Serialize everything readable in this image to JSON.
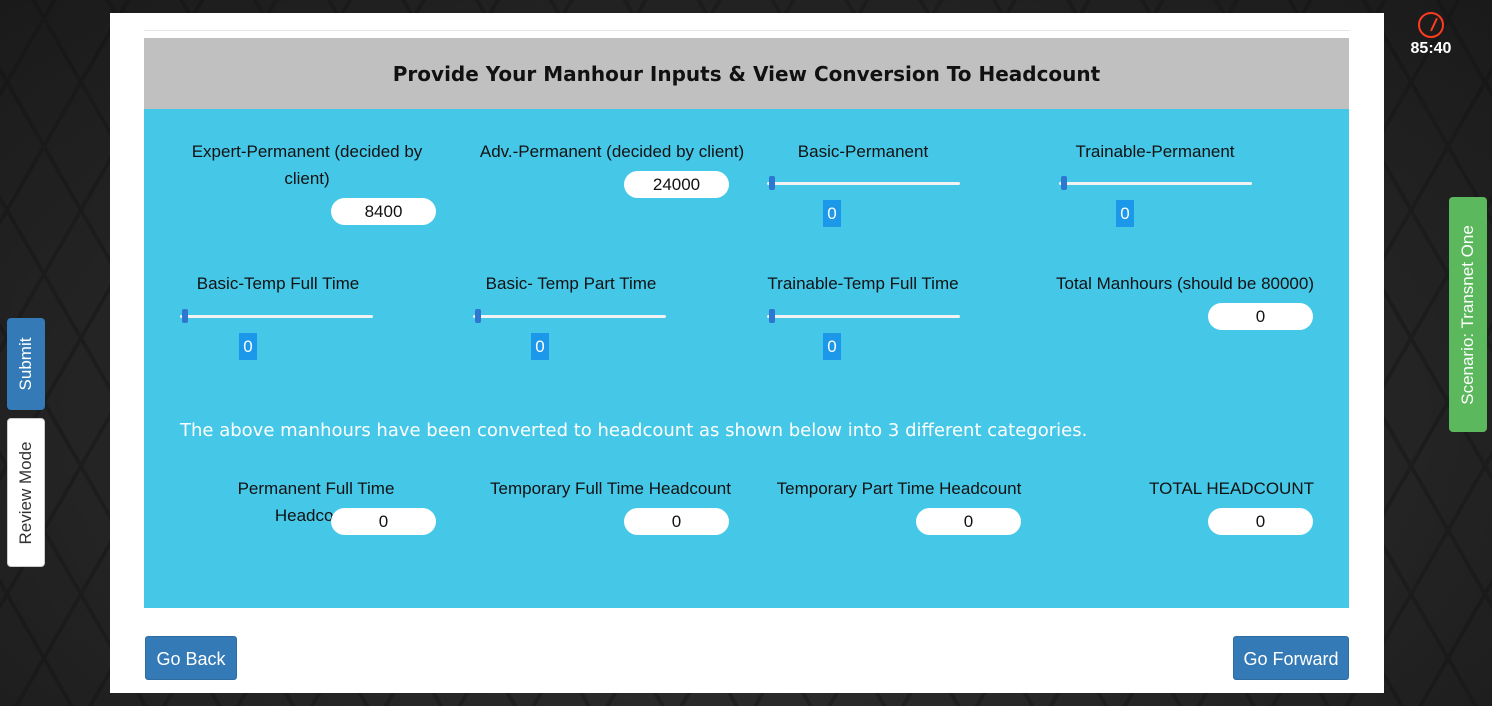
{
  "timer": {
    "time": "85:40",
    "icon": "stopwatch-icon"
  },
  "side_tabs": {
    "submit": "Submit",
    "review": "Review Mode",
    "scenario": "Scenario: Transnet One"
  },
  "header": {
    "title": "Provide Your Manhour Inputs & View Conversion To Headcount"
  },
  "inputs": {
    "expert_permanent": {
      "label": "Expert-Permanent (decided by client)",
      "value": "8400"
    },
    "adv_permanent": {
      "label": "Adv.-Permanent (decided by client)",
      "value": "24000"
    },
    "basic_permanent": {
      "label": "Basic-Permanent",
      "value": "0"
    },
    "trainable_permanent": {
      "label": "Trainable-Permanent",
      "value": "0"
    },
    "basic_temp_full": {
      "label": "Basic-Temp Full Time",
      "value": "0"
    },
    "basic_temp_part": {
      "label": "Basic- Temp Part Time",
      "value": "0"
    },
    "trainable_temp_full": {
      "label": "Trainable-Temp Full Time",
      "value": "0"
    },
    "total_manhours": {
      "label": "Total Manhours (should be 80000)",
      "value": "0"
    }
  },
  "note": "The above manhours have been converted to headcount as shown below into 3 different categories.",
  "headcount": {
    "perm_full": {
      "label": "Permanent Full Time Headcount",
      "value": "0"
    },
    "temp_full": {
      "label": "Temporary Full Time Headcount",
      "value": "0"
    },
    "temp_part": {
      "label": "Temporary Part Time Headcount",
      "value": "0"
    },
    "total": {
      "label": "TOTAL HEADCOUNT",
      "value": "0"
    }
  },
  "nav": {
    "back": "Go Back",
    "forward": "Go Forward"
  },
  "colors": {
    "work_bg": "#45c8e8",
    "header_bg": "#c0c0c0",
    "button": "#337ab7",
    "scenario_tab": "#5cb85c",
    "value_badge": "#1b98e9"
  }
}
